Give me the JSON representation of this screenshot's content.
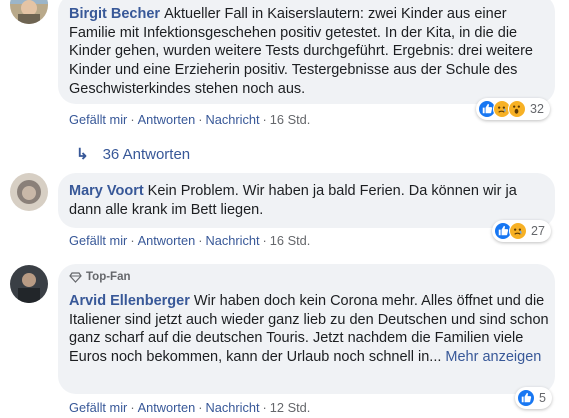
{
  "comments": [
    {
      "author": "Birgit Becher",
      "text": "Aktueller Fall in Kaiserslautern: zwei Kinder aus einer Familie mit Infektionsgeschehen positiv getestet. In der Kita, in die die Kinder gehen, wurden weitere Tests durchgeführt. Ergebnis: drei weitere Kinder und eine Erzieherin positiv. Testergebnisse aus der Schule des Geschwisterkindes stehen noch aus.",
      "like": "Gefällt mir",
      "reply": "Antworten",
      "message": "Nachricht",
      "time": "16 Std.",
      "reactions": [
        "like",
        "sad",
        "wow"
      ],
      "reaction_count": "32"
    },
    {
      "author": "Mary Voort",
      "text": "Kein Problem. Wir haben ja bald Ferien. Da können wir ja dann alle krank im Bett liegen.",
      "like": "Gefällt mir",
      "reply": "Antworten",
      "message": "Nachricht",
      "time": "16 Std.",
      "reactions": [
        "like",
        "sad"
      ],
      "reaction_count": "27"
    },
    {
      "badge": "Top-Fan",
      "author": "Arvid Ellenberger",
      "text": "Wir haben doch kein Corona mehr. Alles öffnet und die Italiener sind jetzt auch wieder ganz lieb zu den Deutschen und sind schon ganz scharf auf die deutschen Touris. Jetzt nachdem die Familien viele Euros noch bekommen, kann der Urlaub noch schnell in...",
      "more": "Mehr anzeigen",
      "like": "Gefällt mir",
      "reply": "Antworten",
      "message": "Nachricht",
      "time": "12 Std.",
      "reactions": [
        "like"
      ],
      "reaction_count": "5"
    }
  ],
  "replies_link": "36 Antworten",
  "replies_arrow": "↳",
  "colors": {
    "link": "#385898",
    "meta": "#65676b",
    "bubble": "#f0f2f5",
    "like_blue": "#1877f2",
    "emoji_yellow": "#f7b125"
  }
}
